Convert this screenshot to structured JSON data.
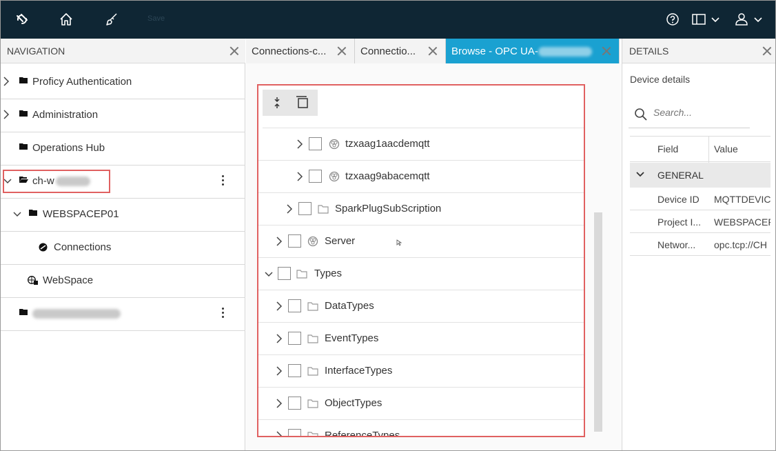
{
  "topbar": {
    "icons": [
      "app-logo-icon",
      "home-icon",
      "brush-icon",
      "help-icon",
      "layout-icon",
      "user-icon"
    ],
    "faded_label": "Save",
    "colors": {
      "background": "#0f2634",
      "icon": "#ffffff"
    }
  },
  "navigation": {
    "title": "NAVIGATION",
    "items": [
      {
        "label": "Proficy Authentication",
        "icon": "folder-icon",
        "expandable": true
      },
      {
        "label": "Administration",
        "icon": "folder-icon",
        "expandable": true
      },
      {
        "label": "Operations Hub",
        "icon": "folder-icon",
        "expandable": false
      },
      {
        "label": "ch-w",
        "icon": "folder-open-icon",
        "expandable": true,
        "expanded": true
      },
      {
        "label": "WEBSPACEP01",
        "icon": "folder-icon",
        "expandable": true,
        "expanded": true
      },
      {
        "label": "Connections",
        "icon": "connections-icon",
        "expandable": false
      },
      {
        "label": "WebSpace",
        "icon": "globe-icon",
        "expandable": false
      },
      {
        "label": "",
        "icon": "folder-icon",
        "expandable": false
      }
    ]
  },
  "tabs": [
    {
      "label": "Connections-c...",
      "active": false
    },
    {
      "label": "Connectio...",
      "active": false
    },
    {
      "label": "Browse - OPC UA-",
      "active": true
    }
  ],
  "tree": {
    "rows": [
      {
        "label": "tzxaag1aacdemqtt",
        "icon": "node-icon",
        "level": 3
      },
      {
        "label": "tzxaag9abacemqtt",
        "icon": "node-icon",
        "level": 3
      },
      {
        "label": "SparkPlugSubScription",
        "icon": "folder-icon",
        "level": 2
      },
      {
        "label": "Server",
        "icon": "node-icon",
        "level": 1
      },
      {
        "label": "Types",
        "icon": "folder-icon",
        "level": 0,
        "expanded": true
      },
      {
        "label": "DataTypes",
        "icon": "folder-icon",
        "level": 1
      },
      {
        "label": "EventTypes",
        "icon": "folder-icon",
        "level": 1
      },
      {
        "label": "InterfaceTypes",
        "icon": "folder-icon",
        "level": 1
      },
      {
        "label": "ObjectTypes",
        "icon": "folder-icon",
        "level": 1
      },
      {
        "label": "ReferenceTypes",
        "icon": "folder-icon",
        "level": 1
      }
    ]
  },
  "details": {
    "title": "DETAILS",
    "subtitle": "Device details",
    "search_placeholder": "Search...",
    "columns": [
      "Field",
      "Value"
    ],
    "group": "GENERAL",
    "rows": [
      {
        "field": "Device ID",
        "value": "MQTTDEVIC"
      },
      {
        "field": "Project I...",
        "value": "WEBSPACEF"
      },
      {
        "field": "Networ...",
        "value": "opc.tcp://CH"
      }
    ]
  },
  "colors": {
    "highlight": "#e06060",
    "active_tab": "#1aa1d1"
  }
}
